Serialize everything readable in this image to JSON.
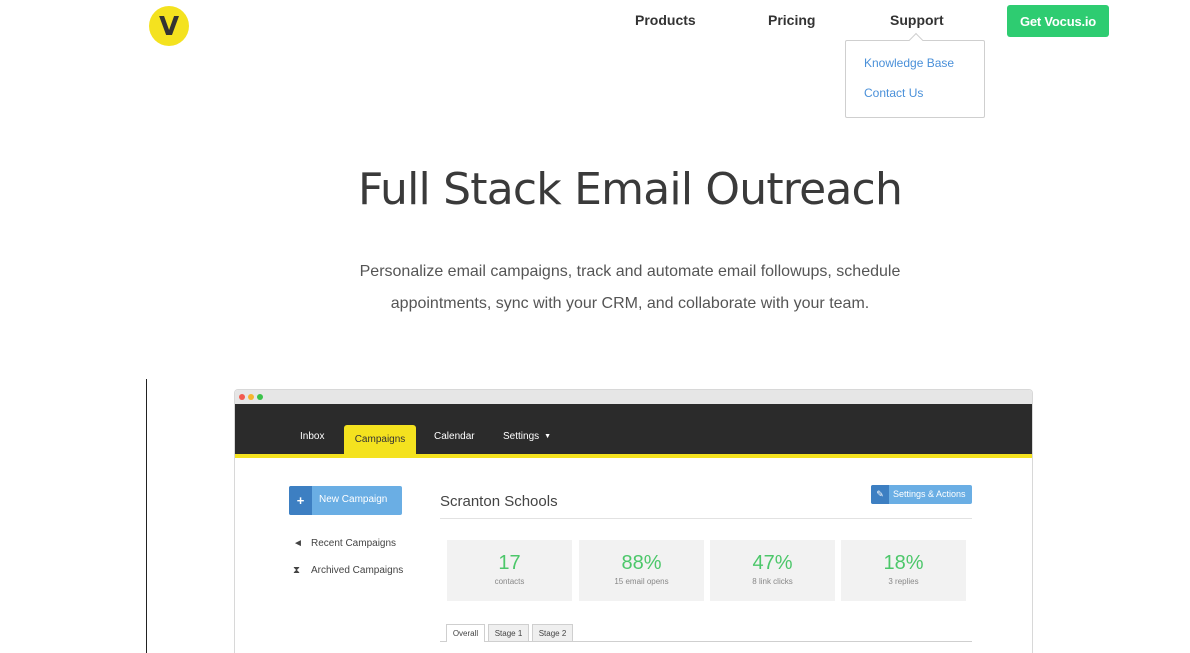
{
  "logo": {
    "letter": "V"
  },
  "nav": {
    "products": "Products",
    "pricing": "Pricing",
    "support": "Support",
    "cta": "Get Vocus.io"
  },
  "support_menu": {
    "items": [
      "Knowledge Base",
      "Contact Us"
    ]
  },
  "hero": {
    "title": "Full Stack Email Outreach",
    "subtitle_line1": "Personalize email campaigns, track and automate email followups, schedule",
    "subtitle_line2": "appointments, sync with your CRM, and collaborate with your team."
  },
  "mockup": {
    "tabs": [
      "Inbox",
      "Campaigns",
      "Calendar",
      "Settings"
    ],
    "active_tab": "Campaigns",
    "new_campaign": "New Campaign",
    "sidebar": [
      "Recent Campaigns",
      "Archived Campaigns"
    ],
    "campaign_title": "Scranton Schools",
    "settings_actions": "Settings & Actions",
    "stats": [
      {
        "value": "17",
        "label": "contacts"
      },
      {
        "value": "88%",
        "label": "15 email opens"
      },
      {
        "value": "47%",
        "label": "8 link clicks"
      },
      {
        "value": "18%",
        "label": "3 replies"
      }
    ],
    "sub_tabs": [
      "Overall",
      "Stage 1",
      "Stage 2"
    ]
  },
  "colors": {
    "brand_yellow": "#f4e21f",
    "cta_green": "#2ecc71",
    "link_blue": "#4a90d9",
    "stat_green": "#4cc76a",
    "button_blue": "#6aaee4"
  }
}
